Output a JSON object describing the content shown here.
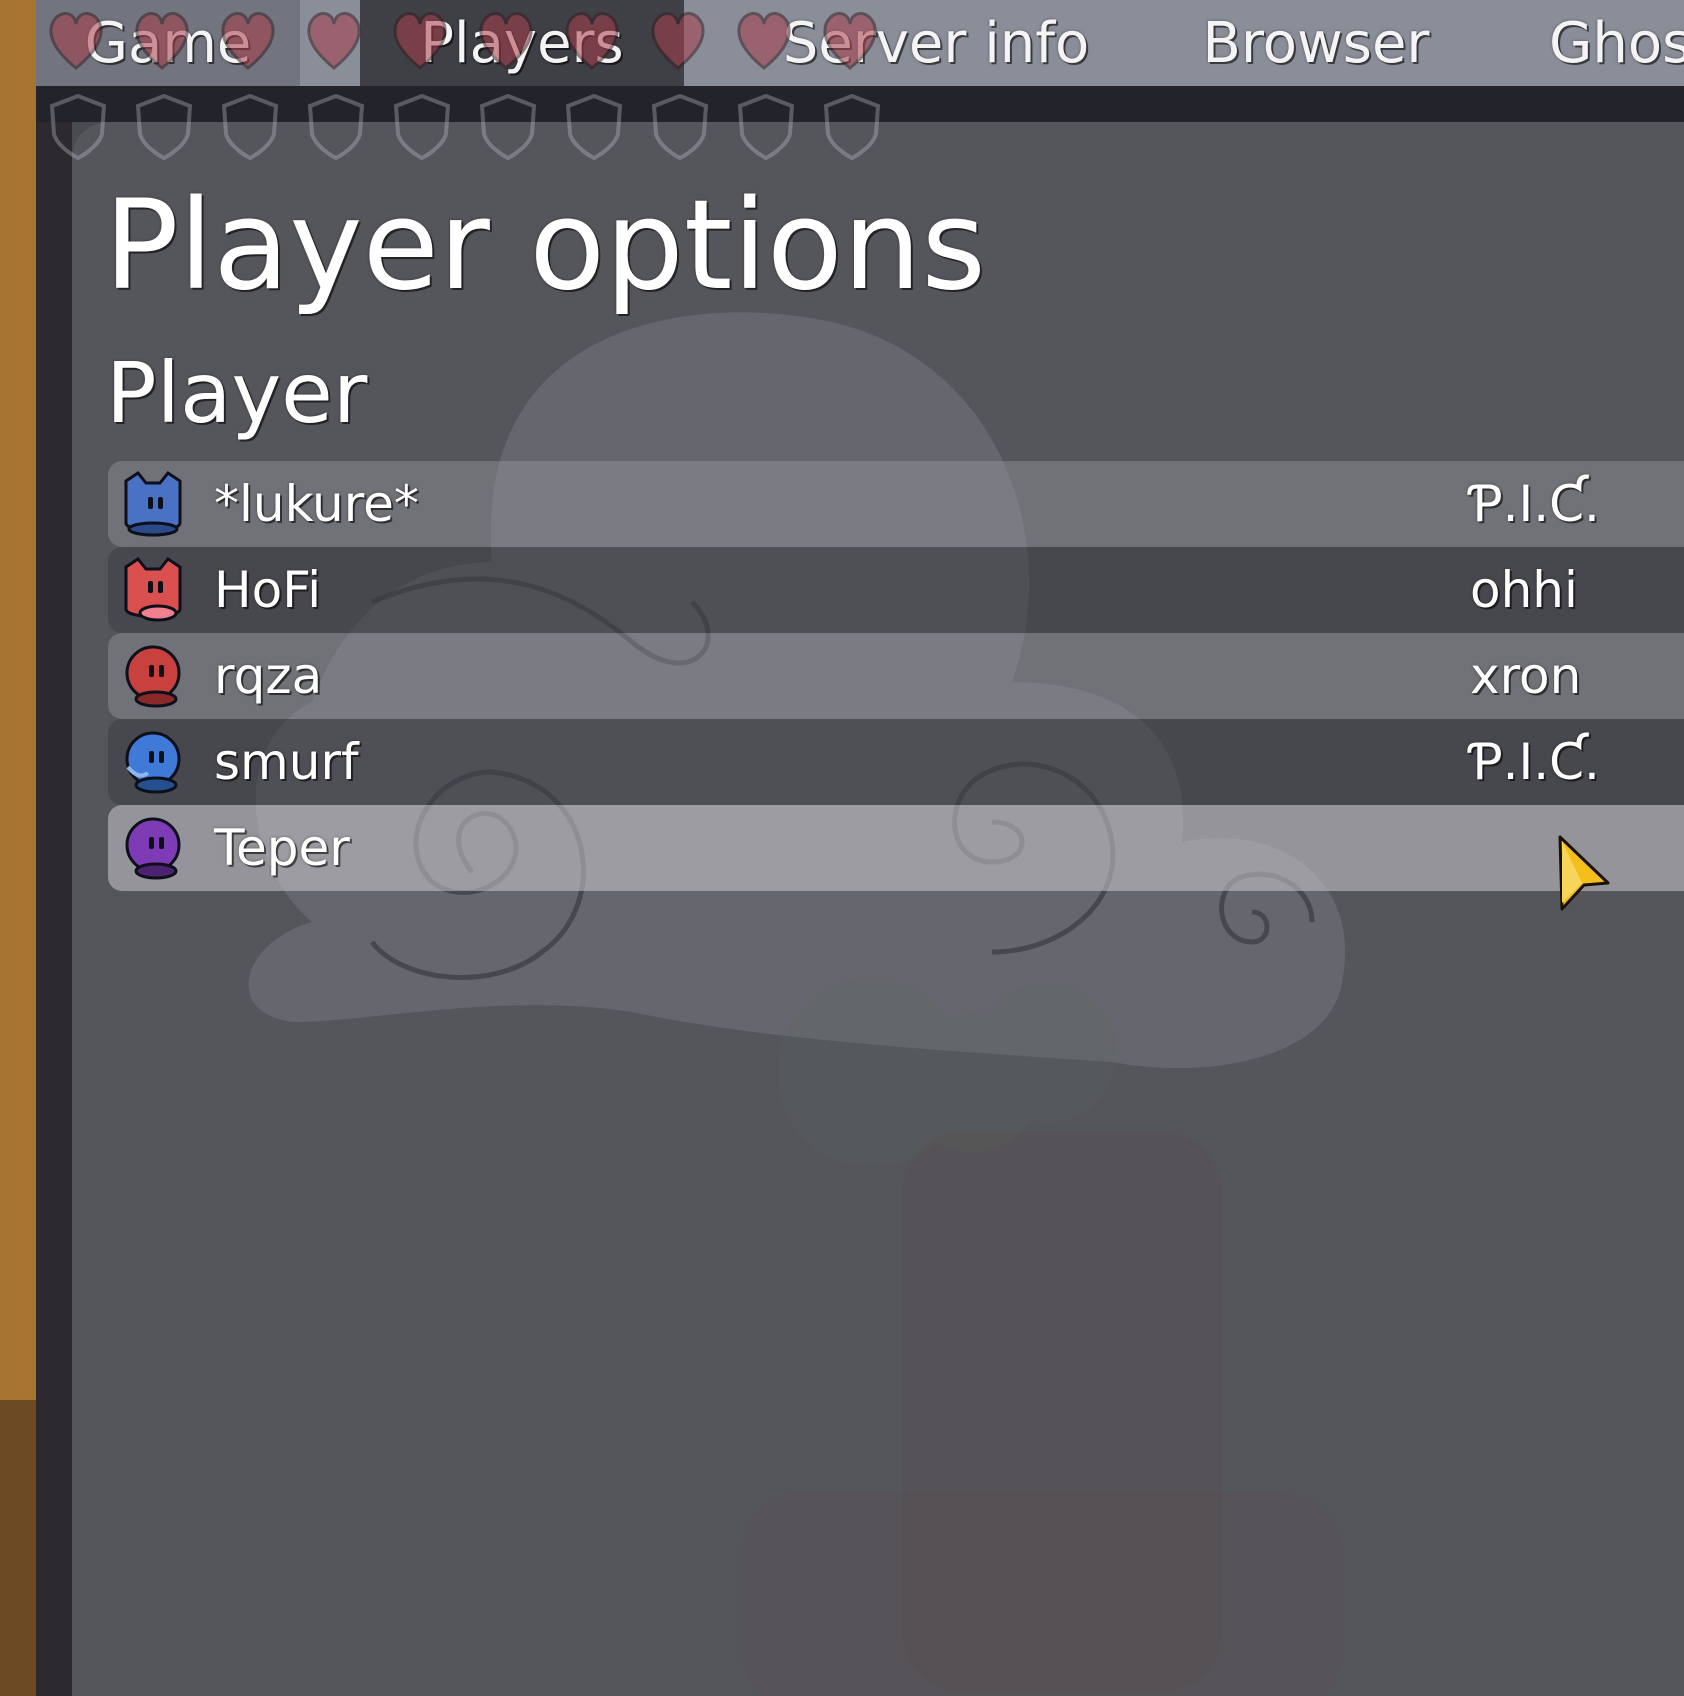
{
  "tabs": [
    {
      "label": "Game",
      "state": "inactive"
    },
    {
      "label": "Players",
      "state": "active"
    },
    {
      "label": "Server info",
      "state": "inactive"
    },
    {
      "label": "Browser",
      "state": "inactive"
    },
    {
      "label": "Ghost",
      "state": "inactive"
    }
  ],
  "panel": {
    "title": "Player options",
    "section_title": "Player"
  },
  "players": [
    {
      "name": "*lukure*",
      "clan": "Ƥ.I.Ƈ.",
      "tee_color": "#4a72c4",
      "tee_style": "cat"
    },
    {
      "name": "HoFi",
      "clan": "ohhi",
      "tee_color": "#d9504f",
      "tee_style": "cat"
    },
    {
      "name": "rqza",
      "clan": "xron",
      "tee_color": "#c8413e",
      "tee_style": "round"
    },
    {
      "name": "smurf",
      "clan": "Ƥ.I.Ƈ.",
      "tee_color": "#3f7ad8",
      "tee_style": "round"
    },
    {
      "name": "Teper",
      "clan": "",
      "tee_color": "#7d3cb5",
      "tee_style": "round"
    }
  ],
  "colors": {
    "accent_cursor": "#f3c01b",
    "panel_bg": "#55565c",
    "tabbar_bg": "#8a8e99"
  },
  "icons": {
    "cursor": "mouse-pointer-icon",
    "hud_hearts": "heart-icon",
    "hud_shields": "shield-icon"
  }
}
